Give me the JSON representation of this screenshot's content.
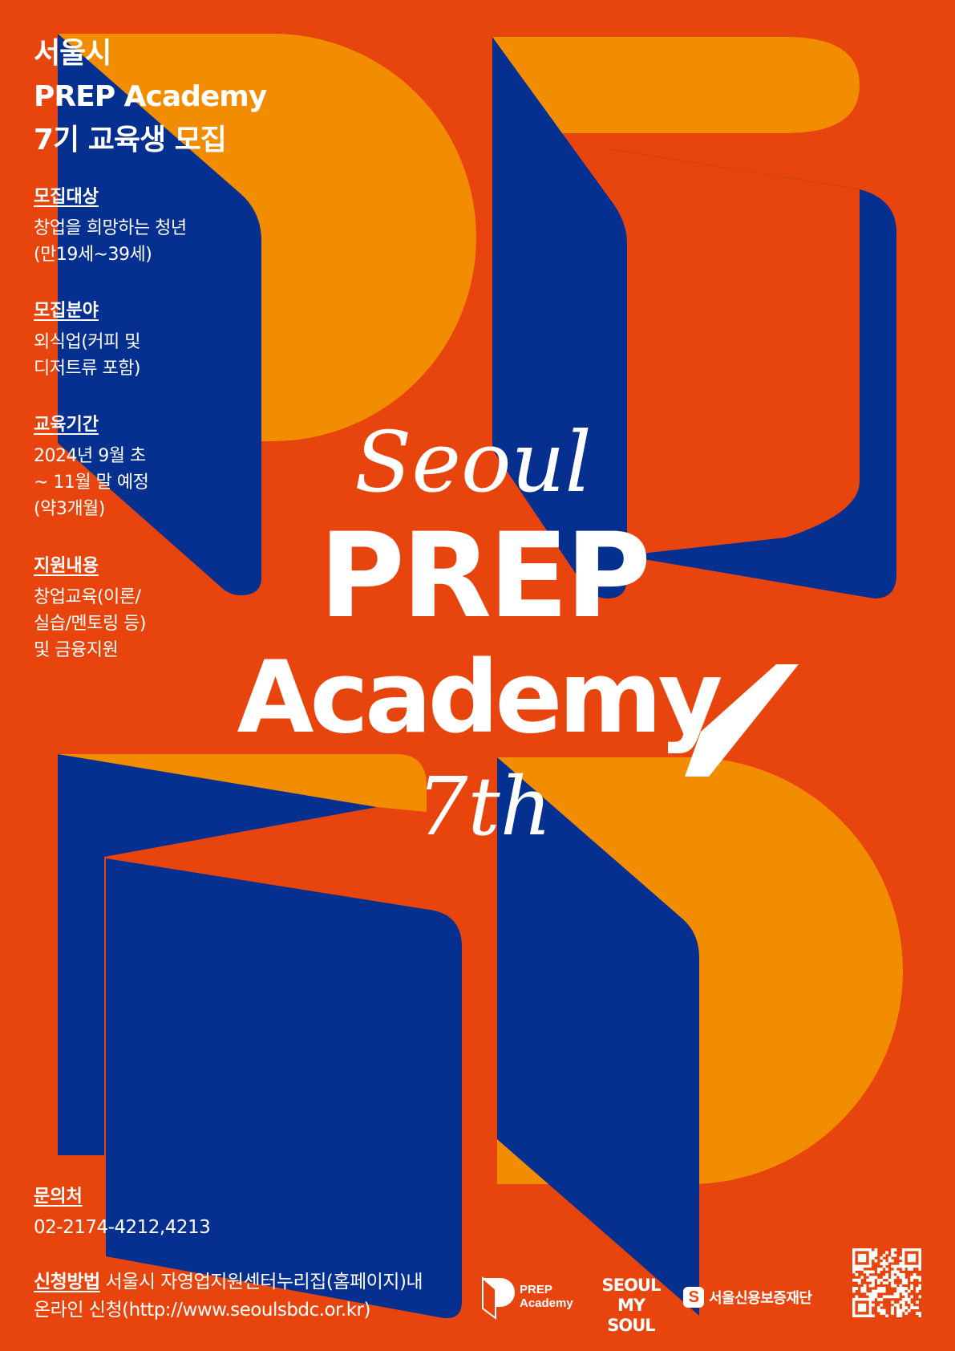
{
  "colors": {
    "background": "#e8450e",
    "navy": "#063090",
    "orange": "#f28c00",
    "white": "#ffffff"
  },
  "headline": {
    "line1": "서울시",
    "line2": "PREP Academy",
    "line3": "7기 교육생 모집"
  },
  "info": [
    {
      "label": "모집대상",
      "lines": [
        "창업을 희망하는 청년",
        "(만19세~39세)"
      ]
    },
    {
      "label": "모집분야",
      "lines": [
        "외식업(커피 및",
        "디저트류 포함)"
      ]
    },
    {
      "label": "교육기간",
      "lines": [
        "2024년 9월 초",
        "~ 11월 말 예정",
        "(약3개월)"
      ]
    },
    {
      "label": "지원내용",
      "lines": [
        "창업교육(이론/",
        "실습/멘토링 등)",
        "및 금융지원"
      ]
    }
  ],
  "title_art": {
    "script_top": "Seoul",
    "main": "PREP",
    "sub": "Academy",
    "script_bottom": "7th"
  },
  "contact": {
    "label": "문의처",
    "phone": "02-2174-4212,4213"
  },
  "apply": {
    "label": "신청방법",
    "line1_rest": " 서울시 자영업지원센터누리집(홈페이지)내",
    "line2": "온라인 신청(http://www.seoulsbdc.or.kr)"
  },
  "footer_logos": {
    "prep_line1": "PREP",
    "prep_line2": "Academy",
    "seoul_line1": "SEOUL",
    "seoul_line2": "MY SOUL",
    "fund_mark": "S",
    "fund_name": "서울신용보증재단",
    "qr_icon": "qr-code-icon"
  }
}
